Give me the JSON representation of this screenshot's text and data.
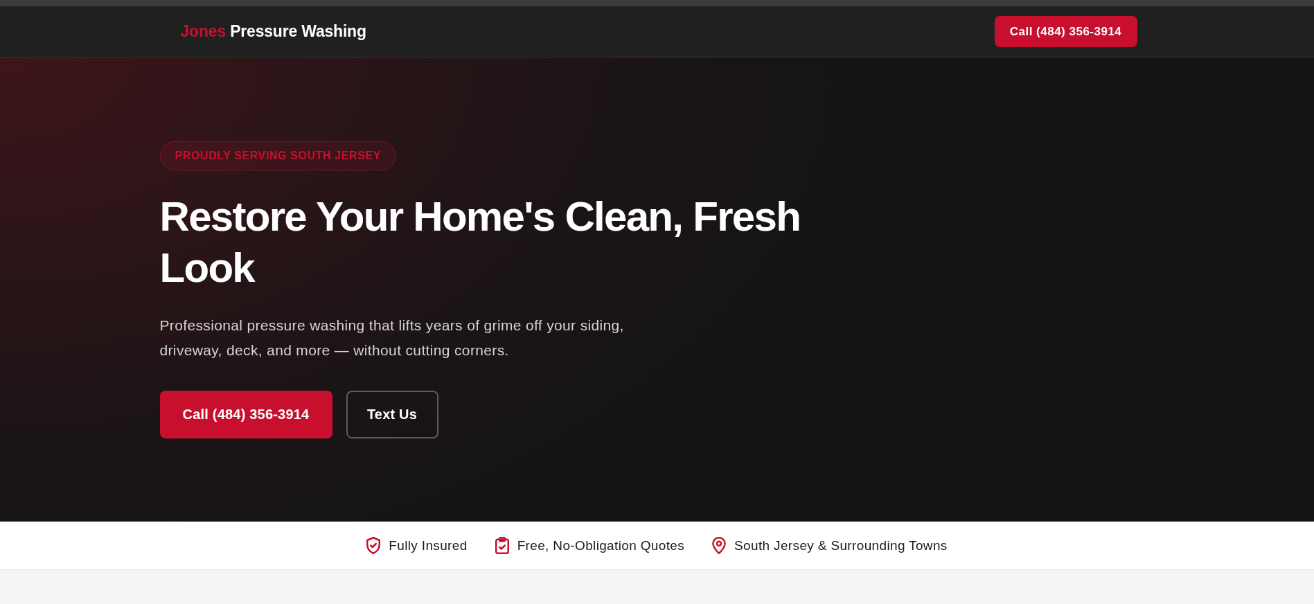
{
  "header": {
    "logo": {
      "accent": "Jones",
      "name": "Pressure Washing"
    },
    "call_button": "Call (484) 356-3914"
  },
  "hero": {
    "badge": "PROUDLY SERVING SOUTH JERSEY",
    "title": "Restore Your Home's Clean, Fresh Look",
    "subtitle": "Professional pressure washing that lifts years of grime off your siding, driveway, deck, and more — without cutting corners.",
    "buttons": [
      {
        "label": "Call (484) 356-3914",
        "kind": "primary"
      },
      {
        "label": "Text Us",
        "kind": "outline"
      }
    ]
  },
  "trust_bar": {
    "items": [
      {
        "kind": "shield",
        "label": "Fully Insured"
      },
      {
        "kind": "clipboard",
        "label": "Free, No-Obligation Quotes"
      },
      {
        "kind": "pin",
        "label": "South Jersey & Surrounding Towns"
      }
    ]
  }
}
